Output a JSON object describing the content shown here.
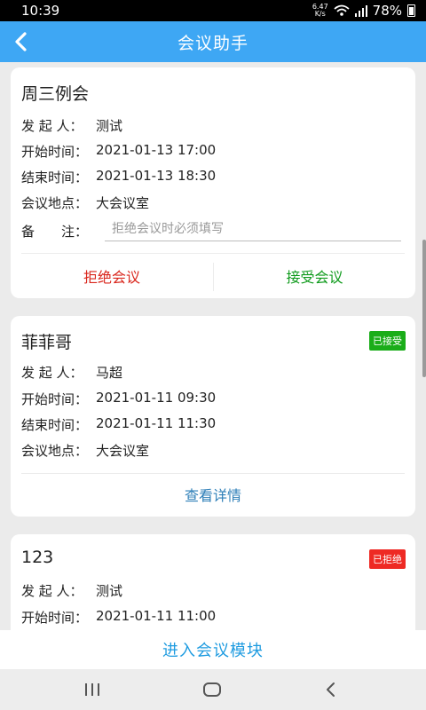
{
  "status_bar": {
    "time": "10:39",
    "speed_value": "6.47",
    "speed_unit": "K/s",
    "battery": "78%"
  },
  "header": {
    "title": "会议助手",
    "back_icon": "back-arrow-icon"
  },
  "meetings": [
    {
      "title": "周三例会",
      "rows": [
        {
          "label": "发 起 人：",
          "value": "测试"
        },
        {
          "label": "开始时间：",
          "value": "2021-01-13 17:00"
        },
        {
          "label": "结束时间：",
          "value": "2021-01-13 18:30"
        },
        {
          "label": "会议地点：",
          "value": "大会议室"
        }
      ],
      "note_label": "备　　注：",
      "note_placeholder": "拒绝会议时必须填写",
      "reject_label": "拒绝会议",
      "accept_label": "接受会议",
      "reject_color": "#d9261c",
      "accept_color": "#0e9a1b"
    },
    {
      "title": "菲菲哥",
      "badge": "已接受",
      "badge_color": "#1aad19",
      "rows": [
        {
          "label": "发 起 人：",
          "value": "马超"
        },
        {
          "label": "开始时间：",
          "value": "2021-01-11 09:30"
        },
        {
          "label": "结束时间：",
          "value": "2021-01-11 11:30"
        },
        {
          "label": "会议地点：",
          "value": "大会议室"
        }
      ],
      "detail_label": "查看详情"
    },
    {
      "title": "123",
      "badge": "已拒绝",
      "badge_color": "#ee2a24",
      "rows": [
        {
          "label": "发 起 人：",
          "value": "测试"
        },
        {
          "label": "开始时间：",
          "value": "2021-01-11 11:00"
        }
      ]
    }
  ],
  "footer": {
    "enter_label": "进入会议模块"
  },
  "colors": {
    "header_bg": "#3ea7f4",
    "link_blue": "#1e9be0",
    "detail_blue": "#2e7fb8"
  },
  "nav": {
    "recent_icon": "recent-apps-icon",
    "home_icon": "home-icon",
    "back_icon": "back-icon"
  }
}
